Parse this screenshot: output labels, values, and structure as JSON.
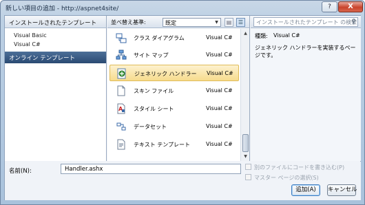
{
  "window": {
    "title": "新しい項目の追加 - http://aspnet4site/",
    "help_label": "?",
    "close_label": "X"
  },
  "left_panel": {
    "header": "インストールされたテンプレート",
    "items": [
      "Visual Basic",
      "Visual C#"
    ],
    "online": "オンライン テンプレート"
  },
  "toolbar": {
    "sort_label": "並べ替え基準:",
    "sort_value": "既定",
    "view_icons": [
      "list-view-icon",
      "detail-view-icon"
    ]
  },
  "templates": [
    {
      "name": "クラス ダイアグラム",
      "lang": "Visual C#",
      "icon": "class-diagram-icon"
    },
    {
      "name": "サイト マップ",
      "lang": "Visual C#",
      "icon": "sitemap-icon"
    },
    {
      "name": "ジェネリック ハンドラー",
      "lang": "Visual C#",
      "icon": "generic-handler-icon",
      "selected": true
    },
    {
      "name": "スキン ファイル",
      "lang": "Visual C#",
      "icon": "skin-file-icon"
    },
    {
      "name": "スタイル シート",
      "lang": "Visual C#",
      "icon": "stylesheet-icon"
    },
    {
      "name": "データセット",
      "lang": "Visual C#",
      "icon": "dataset-icon"
    },
    {
      "name": "テキスト テンプレート",
      "lang": "Visual C#",
      "icon": "text-template-icon"
    }
  ],
  "right_panel": {
    "search_placeholder": "インストールされたテンプレート の検索",
    "type_label": "種類:",
    "type_value": "Visual C#",
    "description": "ジェネリック ハンドラーを実装するページです。"
  },
  "bottom": {
    "name_label": "名前(N):",
    "name_value": "Handler.ashx",
    "checkbox_separate": "別のファイルにコードを書き込む(P)",
    "checkbox_master": "マスター ページの選択(S)",
    "add_button": "追加(A)",
    "cancel_button": "キャンセル"
  },
  "colors": {
    "selection": "#f7dc8d",
    "online_header": "#2a4a73"
  }
}
